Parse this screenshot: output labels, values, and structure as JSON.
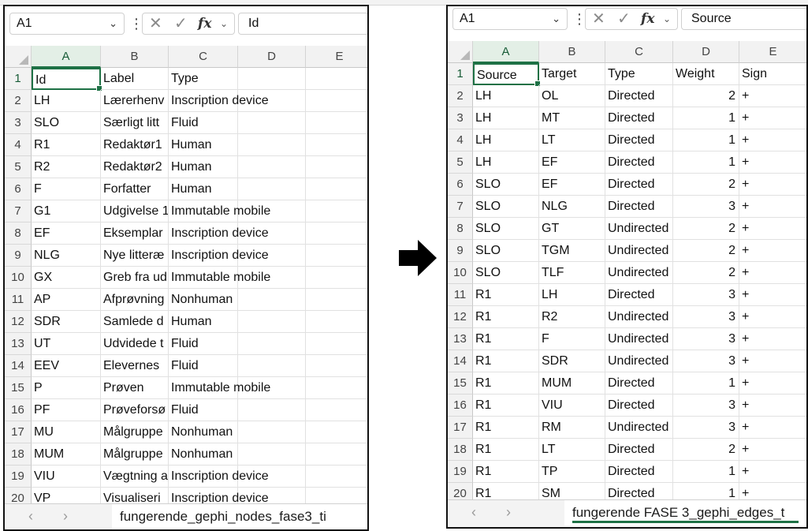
{
  "left": {
    "name_box": "A1",
    "formula_value": "Id",
    "columns": [
      "A",
      "B",
      "C",
      "D",
      "E"
    ],
    "rows": [
      [
        "1",
        "Id",
        "Label",
        "Type"
      ],
      [
        "2",
        "LH",
        "Lærerhenv",
        "Inscription device"
      ],
      [
        "3",
        "SLO",
        "Særligt litt",
        "Fluid"
      ],
      [
        "4",
        "R1",
        "Redaktør1",
        "Human"
      ],
      [
        "5",
        "R2",
        "Redaktør2",
        "Human"
      ],
      [
        "6",
        "F",
        "Forfatter",
        "Human"
      ],
      [
        "7",
        "G1",
        "Udgivelse 1",
        "Immutable mobile"
      ],
      [
        "8",
        "EF",
        "Eksemplar",
        "Inscription device"
      ],
      [
        "9",
        "NLG",
        "Nye litteræ",
        "Inscription device"
      ],
      [
        "10",
        "GX",
        "Greb fra ud",
        "Immutable mobile"
      ],
      [
        "11",
        "AP",
        "Afprøvning",
        "Nonhuman"
      ],
      [
        "12",
        "SDR",
        "Samlede d",
        "Human"
      ],
      [
        "13",
        "UT",
        "Udvidede t",
        "Fluid"
      ],
      [
        "14",
        "EEV",
        "Elevernes",
        "Fluid"
      ],
      [
        "15",
        "P",
        "Prøven",
        "Immutable mobile"
      ],
      [
        "16",
        "PF",
        "Prøveforsø",
        "Fluid"
      ],
      [
        "17",
        "MU",
        "Målgruppe",
        "Nonhuman"
      ],
      [
        "18",
        "MUM",
        "Målgruppe",
        "Nonhuman"
      ],
      [
        "19",
        "VIU",
        "Vægtning a",
        "Inscription device"
      ],
      [
        "20",
        "VP",
        "Visualiseri",
        "Inscription device"
      ]
    ],
    "sheet_tab": "fungerende_gephi_nodes_fase3_ti"
  },
  "right": {
    "name_box": "A1",
    "formula_value": "Source",
    "columns": [
      "A",
      "B",
      "C",
      "D",
      "E"
    ],
    "rows": [
      [
        "1",
        "Source",
        "Target",
        "Type",
        "Weight",
        "Sign"
      ],
      [
        "2",
        "LH",
        "OL",
        "Directed",
        "2",
        "+"
      ],
      [
        "3",
        "LH",
        "MT",
        "Directed",
        "1",
        "+"
      ],
      [
        "4",
        "LH",
        "LT",
        "Directed",
        "1",
        "+"
      ],
      [
        "5",
        "LH",
        "EF",
        "Directed",
        "1",
        "+"
      ],
      [
        "6",
        "SLO",
        "EF",
        "Directed",
        "2",
        "+"
      ],
      [
        "7",
        "SLO",
        "NLG",
        "Directed",
        "3",
        "+"
      ],
      [
        "8",
        "SLO",
        "GT",
        "Undirected",
        "2",
        "+"
      ],
      [
        "9",
        "SLO",
        "TGM",
        "Undirected",
        "2",
        "+"
      ],
      [
        "10",
        "SLO",
        "TLF",
        "Undirected",
        "2",
        "+"
      ],
      [
        "11",
        "R1",
        "LH",
        "Directed",
        "3",
        "+"
      ],
      [
        "12",
        "R1",
        "R2",
        "Undirected",
        "3",
        "+"
      ],
      [
        "13",
        "R1",
        "F",
        "Undirected",
        "3",
        "+"
      ],
      [
        "14",
        "R1",
        "SDR",
        "Undirected",
        "3",
        "+"
      ],
      [
        "15",
        "R1",
        "MUM",
        "Directed",
        "1",
        "+"
      ],
      [
        "16",
        "R1",
        "VIU",
        "Directed",
        "3",
        "+"
      ],
      [
        "17",
        "R1",
        "RM",
        "Undirected",
        "3",
        "+"
      ],
      [
        "18",
        "R1",
        "LT",
        "Directed",
        "2",
        "+"
      ],
      [
        "19",
        "R1",
        "TP",
        "Directed",
        "1",
        "+"
      ],
      [
        "20",
        "R1",
        "SM",
        "Directed",
        "1",
        "+"
      ]
    ],
    "sheet_tab": "fungerende FASE 3_gephi_edges_t"
  },
  "icons": {
    "chevron": "chevron-down-icon",
    "more": "more-vertical-icon",
    "cancel": "cancel-x-icon",
    "enter": "check-icon",
    "function": "fx-icon",
    "arrow": "right-arrow-icon",
    "prev": "chevron-left-icon",
    "next": "chevron-right-icon"
  },
  "colors": {
    "excel_green": "#1e7145",
    "header_bg": "#f2f2f2"
  }
}
